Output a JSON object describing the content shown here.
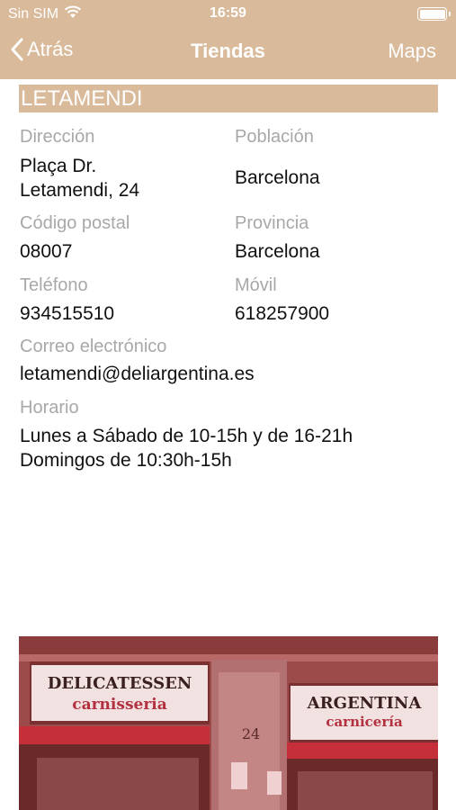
{
  "status_bar": {
    "carrier": "Sin SIM",
    "time": "16:59"
  },
  "nav": {
    "back_label": "Atrás",
    "title": "Tiendas",
    "maps_label": "Maps"
  },
  "store": {
    "name": "LETAMENDI",
    "direccion_label": "Dirección",
    "direccion_line1": "Plaça Dr.",
    "direccion_line2": "Letamendi, 24",
    "poblacion_label": "Población",
    "poblacion": "Barcelona",
    "codigo_postal_label": "Código postal",
    "codigo_postal": "08007",
    "provincia_label": "Provincia",
    "provincia": "Barcelona",
    "telefono_label": "Teléfono",
    "telefono": "934515510",
    "movil_label": "Móvil",
    "movil": "618257900",
    "correo_label": "Correo electrónico",
    "correo": "letamendi@deliargentina.es",
    "horario_label": "Horario",
    "horario_line1": "Lunes a Sábado de 10-15h y de 16-21h",
    "horario_line2": "Domingos de 10:30h-15h"
  },
  "photo": {
    "left_sign_top": "DELICATESSEN",
    "left_sign_bottom": "carnisseria",
    "right_sign_top": "ARGENTINA",
    "right_sign_bottom": "carnicería",
    "street_number": "24"
  },
  "colors": {
    "accent": "#d9ba9b",
    "label_gray": "#a8a8a8",
    "photo_tint": "#9c4444"
  }
}
